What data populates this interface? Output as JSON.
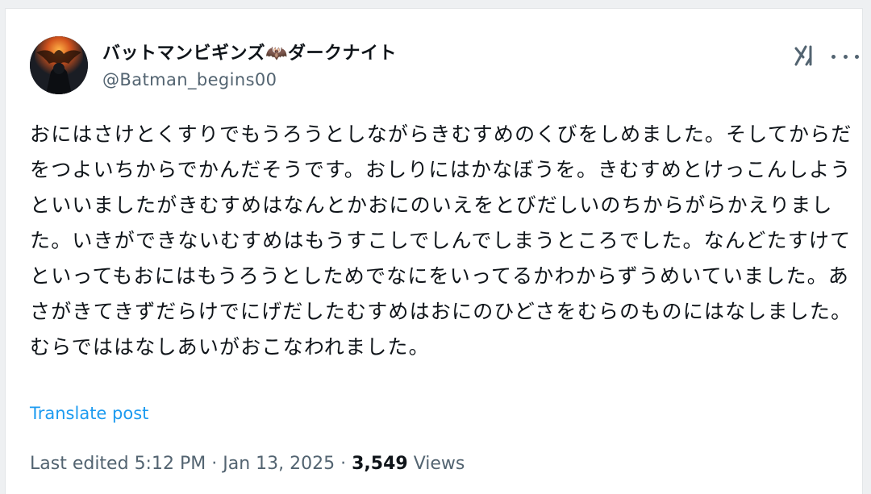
{
  "post": {
    "author": {
      "display_name": "バットマンビギンズ🦇ダークナイト",
      "handle": "@Batman_begins00",
      "avatar": "avatar-batman"
    },
    "icons": {
      "grok": "grok-icon",
      "more": "more-icon"
    },
    "text": "おにはさけとくすりでもうろうとしながらきむすめのくびをしめました。そしてからだをつよいちからでかんだそうです。おしりにはかなぼうを。きむすめとけっこんしようといいましたがきむすめはなんとかおにのいえをとびだしいのちからがらかえりました。いきができないむすめはもうすこしでしんでしまうところでした。なんどたすけてといってもおにはもうろうとしためでなにをいってるかわからずうめいていました。あさがきてきずだらけでにげだしたむすめはおにのひどさをむらのものにはなしました。むらでははなしあいがおこなわれました。",
    "translate_label": "Translate post",
    "meta": {
      "edited_label": "Last edited",
      "time": "5:12 PM",
      "separator": "·",
      "date": "Jan 13, 2025",
      "views_count": "3,549",
      "views_label": "Views"
    }
  },
  "colors": {
    "text_primary": "#0f1419",
    "text_secondary": "#536471",
    "link": "#1d9bf0"
  }
}
